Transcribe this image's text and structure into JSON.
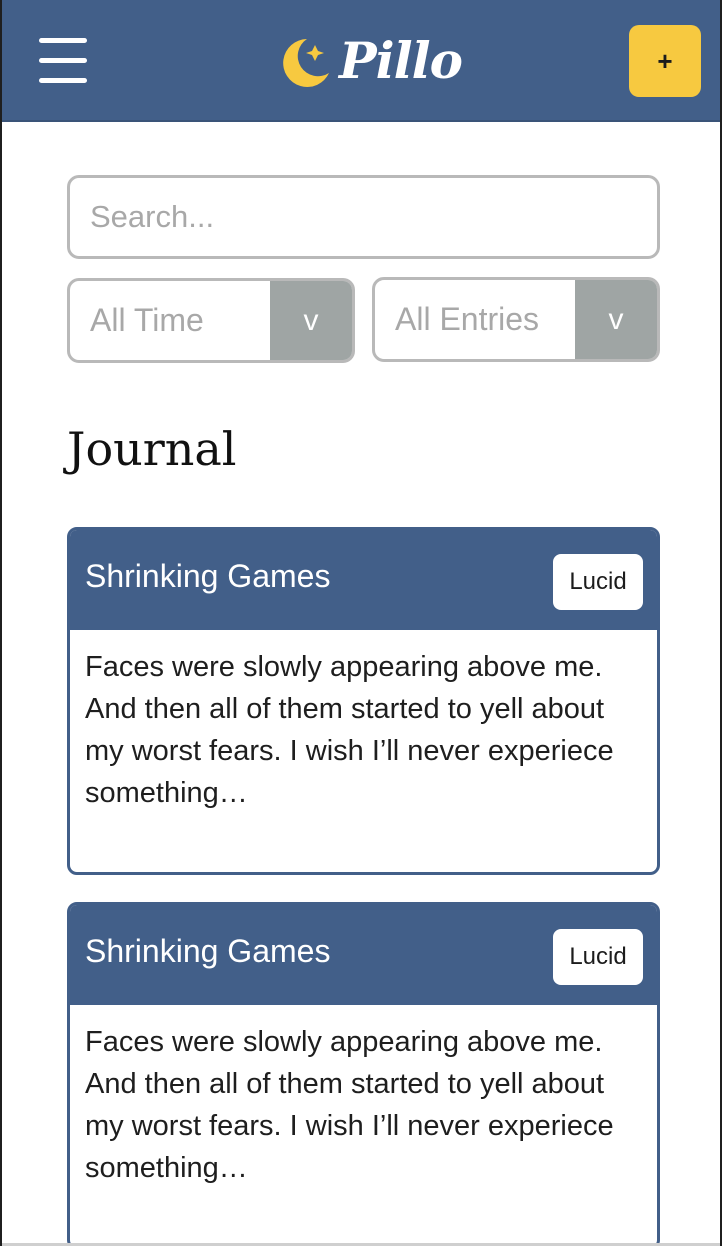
{
  "header": {
    "app_name": "Pillo",
    "add_label": "+"
  },
  "filters": {
    "search_placeholder": "Search...",
    "time_select": "All Time",
    "entries_select": "All Entries",
    "caret": "v"
  },
  "page": {
    "title": "Journal"
  },
  "entries": [
    {
      "title": "Shrinking Games",
      "tag": "Lucid",
      "excerpt": "Faces were slowly appearing above me. And then all of them started to yell about my worst fears. I wish I’ll never experiece something…"
    },
    {
      "title": "Shrinking Games",
      "tag": "Lucid",
      "excerpt": "Faces were slowly appearing above me. And then all of them started to yell about my worst fears. I wish I’ll never experiece something…"
    }
  ],
  "colors": {
    "header_bg": "#425f89",
    "accent_yellow": "#f7c940",
    "caret_bg": "#9fa5a4"
  },
  "icons": {
    "menu": "hamburger-menu-icon",
    "logo": "crescent-moon-star-icon"
  }
}
